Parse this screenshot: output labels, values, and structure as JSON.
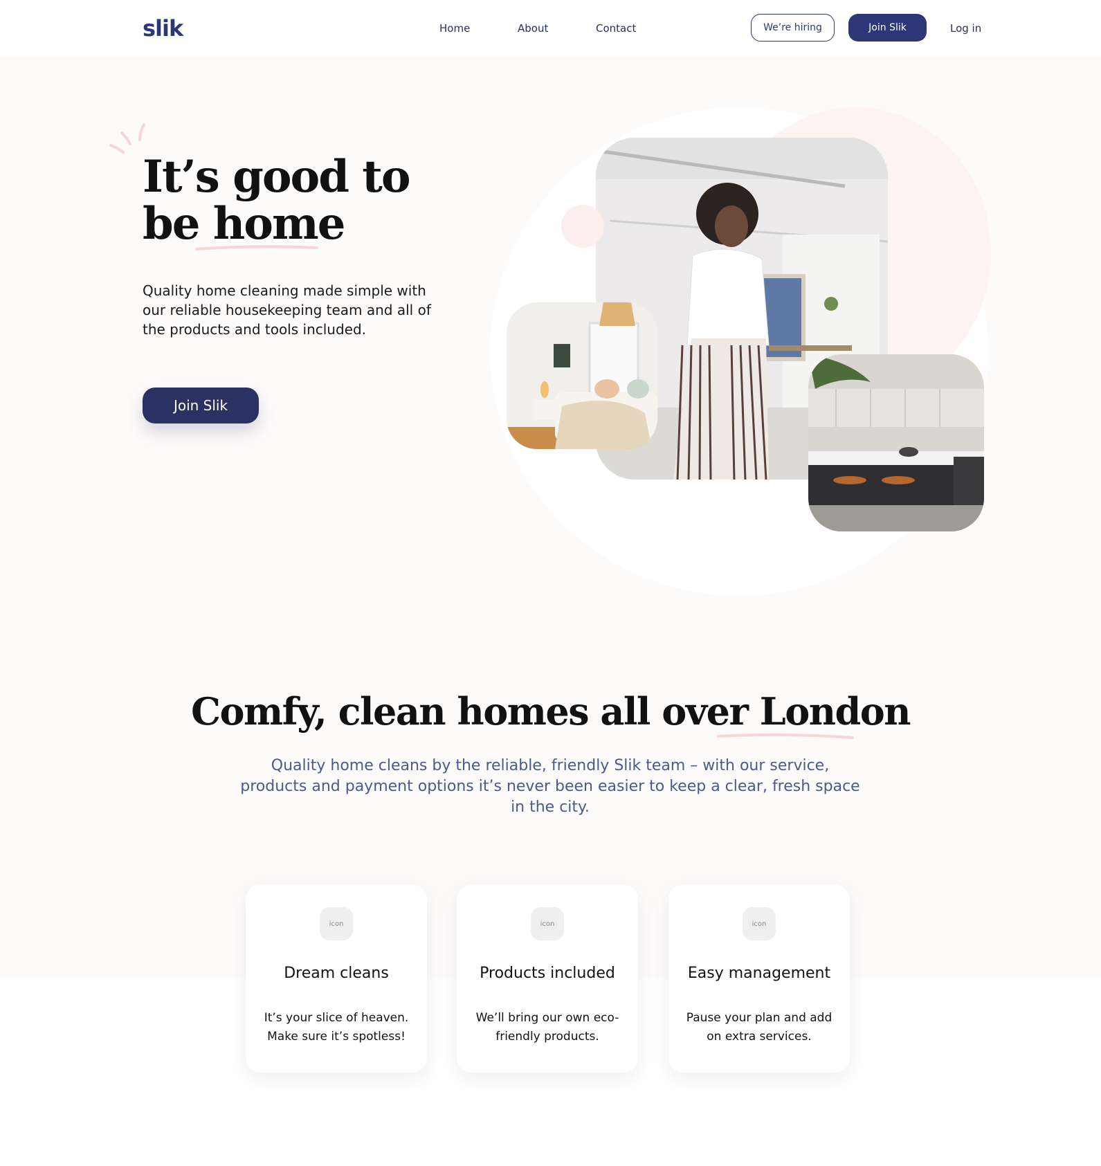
{
  "header": {
    "logo": "slik",
    "nav": [
      "Home",
      "About",
      "Contact"
    ],
    "hiring_label": "We’re hiring",
    "join_label": "Join Slik",
    "login_label": "Log in"
  },
  "hero": {
    "title_line1": "It’s good to",
    "title_line2": "be home",
    "description": "Quality home cleaning made simple with our reliable housekeeping team and all of the products and tools included.",
    "cta_label": "Join Slik"
  },
  "section": {
    "title": "Comfy, clean homes all over London",
    "subtitle": "Quality home cleans by the reliable, friendly Slik team – with our service, products and payment options it’s never been easier to keep a clear, fresh space in the city."
  },
  "cards": [
    {
      "icon_text": "icon",
      "title": "Dream cleans",
      "text": "It’s your slice of heaven. Make sure it’s spotless!"
    },
    {
      "icon_text": "icon",
      "title": "Products included",
      "text": "We’ll bring our own eco-friendly products."
    },
    {
      "icon_text": "icon",
      "title": "Easy management",
      "text": "Pause your plan and add on extra services."
    }
  ],
  "colors": {
    "brand": "#2e3775",
    "cta": "#2b3162",
    "accent_pink": "#f6d6d6",
    "background": "#fdfafa"
  }
}
